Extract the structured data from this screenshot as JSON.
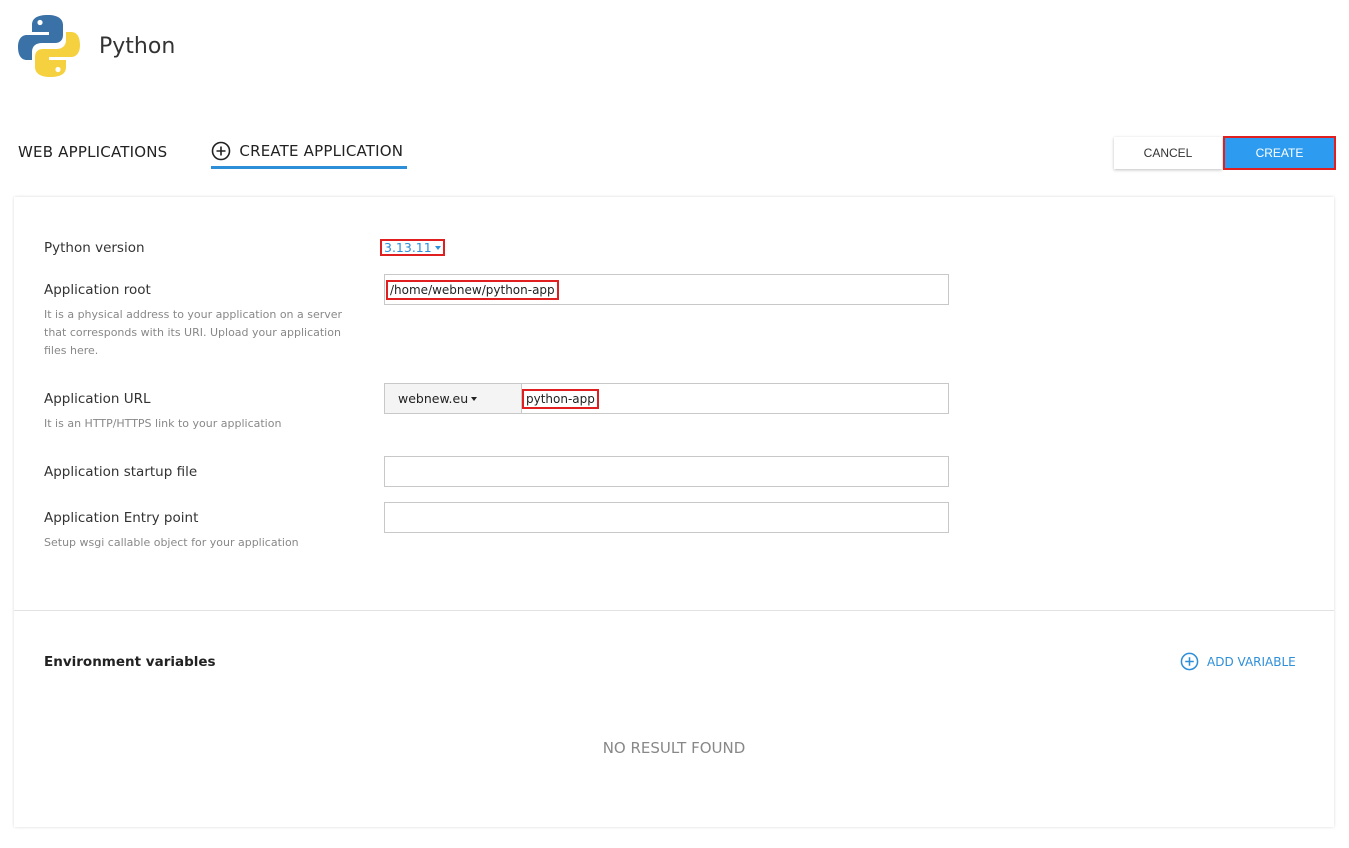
{
  "app": {
    "title": "Python"
  },
  "tabs": {
    "web_applications": "WEB APPLICATIONS",
    "create_application": "CREATE APPLICATION"
  },
  "actions": {
    "cancel": "CANCEL",
    "create": "CREATE"
  },
  "form": {
    "python_version": {
      "label": "Python version",
      "value": "3.13.11"
    },
    "app_root": {
      "label": "Application root",
      "help": "It is a physical address to your application on a server that corresponds with its URI. Upload your application files here.",
      "value": "/home/webnew/python-app"
    },
    "app_url": {
      "label": "Application URL",
      "help": "It is an HTTP/HTTPS link to your application",
      "domain": "webnew.eu",
      "path": "python-app"
    },
    "startup_file": {
      "label": "Application startup file",
      "value": ""
    },
    "entry_point": {
      "label": "Application Entry point",
      "help": "Setup wsgi callable object for your application",
      "value": ""
    }
  },
  "env": {
    "title": "Environment variables",
    "add_label": "ADD VARIABLE",
    "empty_text": "NO RESULT FOUND"
  },
  "colors": {
    "accent": "#2d9cf0",
    "highlight": "#e02020",
    "link": "#2d8fd8"
  }
}
